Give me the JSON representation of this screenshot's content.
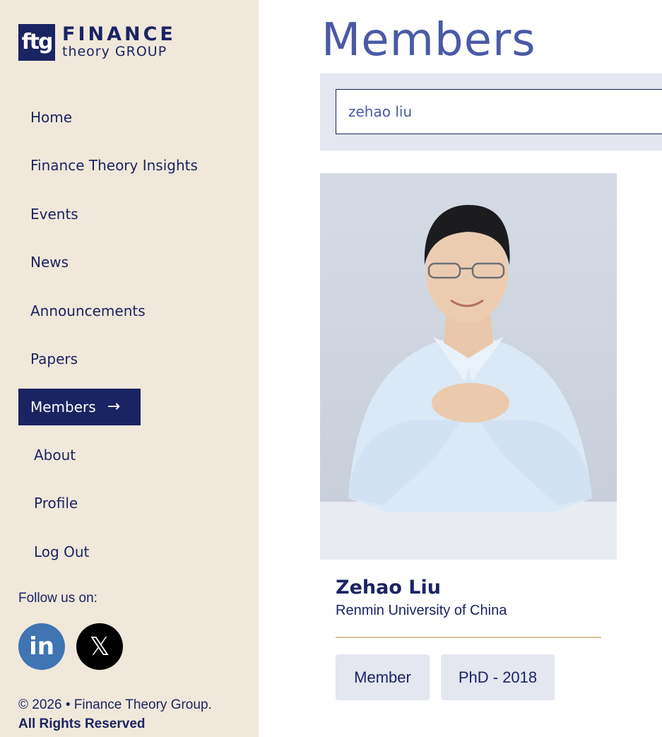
{
  "logo": {
    "mark": "ftg",
    "line1": "FINANCE",
    "line2": "theory GROUP"
  },
  "nav": {
    "items": [
      {
        "label": "Home"
      },
      {
        "label": "Finance Theory Insights"
      },
      {
        "label": "Events"
      },
      {
        "label": "News"
      },
      {
        "label": "Announcements"
      },
      {
        "label": "Papers"
      },
      {
        "label": "Members",
        "active": true
      },
      {
        "label": "About"
      },
      {
        "label": "Profile"
      },
      {
        "label": "Log Out"
      }
    ],
    "active_arrow": "→"
  },
  "social": {
    "follow_label": "Follow us on:",
    "linkedin_glyph": "in",
    "x_glyph": "𝕏"
  },
  "footer": {
    "copyright": "© 2026 • Finance Theory Group.",
    "rights": "All Rights Reserved"
  },
  "main": {
    "title": "Members",
    "search": {
      "value": "zehao liu",
      "placeholder": ""
    },
    "member": {
      "name": "Zehao Liu",
      "affiliation": "Renmin University of China",
      "tags": [
        "Member",
        "PhD - 2018"
      ]
    }
  },
  "colors": {
    "sidebar_bg": "#f0e8da",
    "navy": "#1b2463",
    "title_blue": "#4b5aa6",
    "search_bg": "#e4e6f0",
    "divider_gold": "#d6c39a",
    "linkedin_blue": "#3f75b3"
  }
}
